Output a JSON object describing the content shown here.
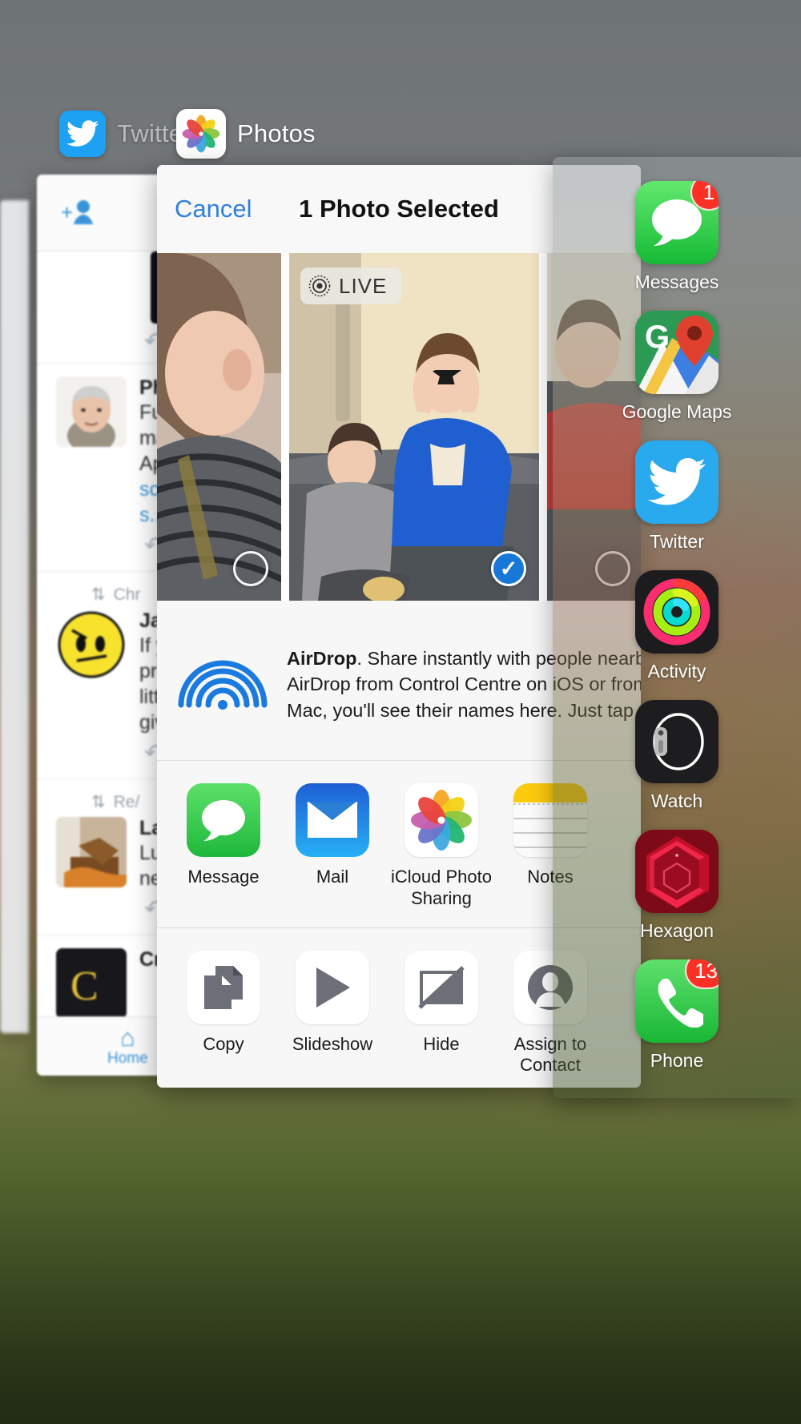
{
  "switcher": {
    "twitter_app": "Twitter",
    "photos_app": "Photos"
  },
  "twitter_card": {
    "tweets": [
      {
        "context": "",
        "name": "Phi",
        "lines": [
          "Fur",
          "ma",
          "App",
          "sco",
          "s..."
        ],
        "avatar": "face-photo"
      },
      {
        "context": "Chr",
        "name": "Jac",
        "lines": [
          "If y",
          "pro",
          "littl",
          "giv"
        ],
        "avatar": "angry-face-emoji"
      },
      {
        "context": "Re/",
        "name": "Lau",
        "lines": [
          "Lun",
          "ned"
        ],
        "avatar": "food-photo"
      },
      {
        "context": "",
        "name": "Cra",
        "lines": [],
        "avatar": "dark-logo"
      }
    ],
    "tab_home": "Home",
    "icons": {
      "compose": "compose-icon",
      "retweet": "retweet-icon",
      "reply": "reply-icon",
      "home": "home-icon"
    }
  },
  "share_sheet": {
    "cancel_label": "Cancel",
    "title": "1 Photo Selected",
    "live_badge": "LIVE",
    "photos": [
      {
        "name": "photo-boy-striped-shirt",
        "selected": false,
        "live": false
      },
      {
        "name": "photo-woman-and-boy-sofa",
        "selected": true,
        "live": true
      },
      {
        "name": "photo-third-partial",
        "selected": false,
        "live": false
      }
    ],
    "airdrop": {
      "title": "AirDrop",
      "line1": ". Share instantly with people nearby.",
      "line2": "AirDrop from Control Centre on iOS or from F",
      "line3": "Mac, you'll see their names here. Just tap to "
    },
    "apps": [
      {
        "label": "Message",
        "icon": "messages-icon"
      },
      {
        "label": "Mail",
        "icon": "mail-icon"
      },
      {
        "label": "iCloud Photo Sharing",
        "icon": "photos-icon"
      },
      {
        "label": "Notes",
        "icon": "notes-icon"
      }
    ],
    "actions": [
      {
        "label": "Copy",
        "icon": "copy-icon"
      },
      {
        "label": "Slideshow",
        "icon": "play-icon"
      },
      {
        "label": "Hide",
        "icon": "hide-icon"
      },
      {
        "label": "Assign to Contact",
        "icon": "contact-icon"
      }
    ]
  },
  "dock": {
    "items": [
      {
        "label": "Messages",
        "icon": "messages-icon",
        "badge": "1"
      },
      {
        "label": "Google Maps",
        "icon": "google-maps-icon",
        "badge": ""
      },
      {
        "label": "Twitter",
        "icon": "twitter-icon",
        "badge": ""
      },
      {
        "label": "Activity",
        "icon": "activity-icon",
        "badge": ""
      },
      {
        "label": "Watch",
        "icon": "watch-icon",
        "badge": ""
      },
      {
        "label": "Hexagon",
        "icon": "hexagon-icon",
        "badge": ""
      },
      {
        "label": "Phone",
        "icon": "phone-icon",
        "badge": "13"
      }
    ]
  },
  "colors": {
    "accent_blue": "#2f7fe0",
    "badge_red": "#fc3126",
    "select_blue": "#1878d8",
    "messages_green": "#4cd964",
    "twitter_blue": "#1da1f2"
  }
}
